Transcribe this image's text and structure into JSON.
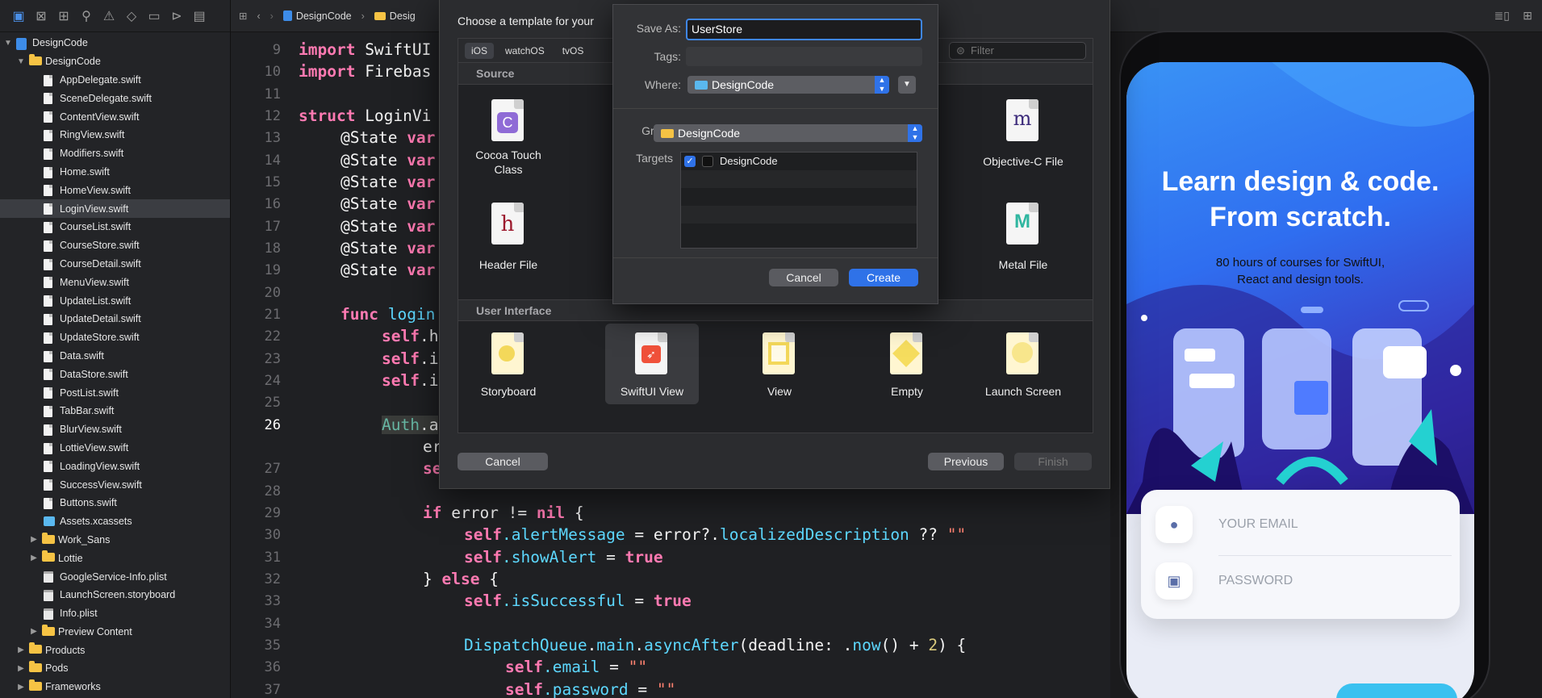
{
  "navigator": {
    "project": "DesignCode",
    "group": "DesignCode",
    "files": [
      "AppDelegate.swift",
      "SceneDelegate.swift",
      "ContentView.swift",
      "RingView.swift",
      "Modifiers.swift",
      "Home.swift",
      "HomeView.swift",
      "LoginView.swift",
      "CourseList.swift",
      "CourseStore.swift",
      "CourseDetail.swift",
      "MenuView.swift",
      "UpdateList.swift",
      "UpdateDetail.swift",
      "UpdateStore.swift",
      "Data.swift",
      "DataStore.swift",
      "PostList.swift",
      "TabBar.swift",
      "BlurView.swift",
      "LottieView.swift",
      "LoadingView.swift",
      "SuccessView.swift",
      "Buttons.swift"
    ],
    "selected_file": "LoginView.swift",
    "assets": "Assets.xcassets",
    "subgroups_a": [
      "Work_Sans",
      "Lottie"
    ],
    "plists": [
      "GoogleService-Info.plist",
      "LaunchScreen.storyboard",
      "Info.plist"
    ],
    "preview_content": "Preview Content",
    "top_groups": [
      "Products",
      "Pods",
      "Frameworks"
    ]
  },
  "jumpbar": {
    "item1": "DesignCode",
    "item2": "Desig"
  },
  "code": {
    "lines": [
      "9",
      "10",
      "11",
      "12",
      "13",
      "14",
      "15",
      "16",
      "17",
      "18",
      "19",
      "20",
      "21",
      "22",
      "23",
      "24",
      "25",
      "26",
      "",
      "27",
      "28",
      "29",
      "30",
      "31",
      "32",
      "33",
      "34",
      "35",
      "36",
      "37"
    ],
    "t_import": "import",
    "t_swiftui": " SwiftUI",
    "t_firebase": " Firebas",
    "t_struct": "struct",
    "t_loginvi": " LoginVi",
    "t_state": "@State",
    "t_var": " var",
    "t_func": "func",
    "t_login": " login",
    "t_self": "self",
    "t_h": ".h",
    "t_i": ".i",
    "t_auth": "Auth",
    "t_a": ".a",
    "t_er": "er",
    "t_se": "se",
    "t_if": "if",
    "t_error_nil": " error != ",
    "t_nil": "nil",
    "t_brace": " {",
    "t_alertmsg": ".alertMessage",
    "t_eq_error": " = error?.",
    "t_locdesc": "localizedDescription",
    "t_qq": " ?? ",
    "t_empty_str": "\"\"",
    "t_showalert": ".showAlert",
    "t_eq": " = ",
    "t_true": "true",
    "t_close_else": "} ",
    "t_else": "else",
    "t_issuccessful": ".isSuccessful",
    "t_dispatch": "DispatchQueue",
    "t_dot": ".",
    "t_main": "main",
    "t_asyncafter": "asyncAfter",
    "t_deadline": "(deadline: .",
    "t_now": "now",
    "t_plus": "() + ",
    "t_two": "2",
    "t_close_brace": ") {",
    "t_email": ".email",
    "t_password": ".password"
  },
  "template_dialog": {
    "title": "Choose a template for your",
    "platform_tabs": [
      "iOS",
      "watchOS",
      "tvOS"
    ],
    "filter_placeholder": "Filter",
    "source_header": "Source",
    "source_items": [
      "Cocoa Touch Class",
      "Header File",
      "Objective-C File",
      "Metal File"
    ],
    "ui_header": "User Interface",
    "ui_items": [
      "Storyboard",
      "SwiftUI View",
      "View",
      "Empty",
      "Launch Screen"
    ],
    "cancel": "Cancel",
    "previous": "Previous",
    "finish": "Finish"
  },
  "save_sheet": {
    "save_as_label": "Save As:",
    "save_as_value": "UserStore",
    "tags_label": "Tags:",
    "where_label": "Where:",
    "where_value": "DesignCode",
    "group_label": "Group",
    "group_value": "DesignCode",
    "targets_label": "Targets",
    "target_name": "DesignCode",
    "target_checked": true,
    "cancel": "Cancel",
    "create": "Create"
  },
  "preview": {
    "title_line1": "Learn design & code.",
    "title_line2": "From scratch.",
    "subtitle_line1": "80 hours of courses for SwiftUI,",
    "subtitle_line2": "React and design tools.",
    "email_placeholder": "YOUR EMAIL",
    "password_placeholder": "PASSWORD"
  },
  "colors": {
    "accent": "#2f72e8",
    "keyword": "#ff7ab2",
    "string": "#ff8170",
    "folder": "#f6c344"
  }
}
